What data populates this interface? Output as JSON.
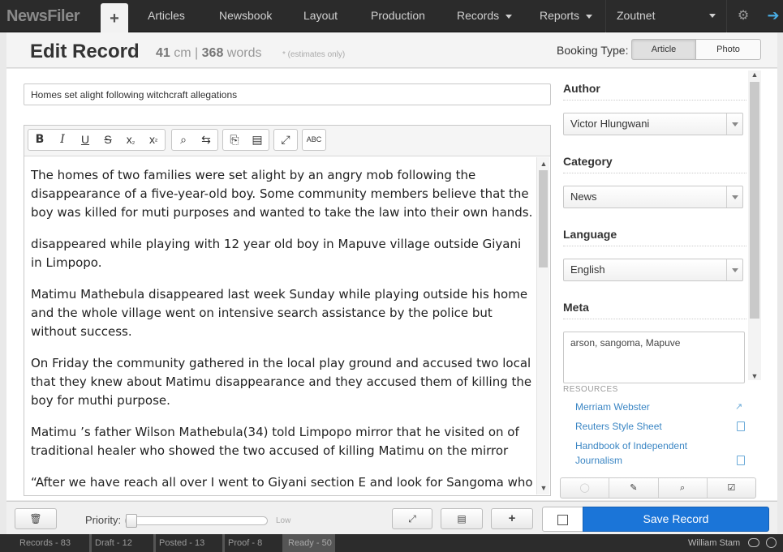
{
  "app": {
    "brand": "NewsFiler"
  },
  "nav": {
    "plus": "+",
    "items": [
      {
        "label": "Articles"
      },
      {
        "label": "Newsbook"
      },
      {
        "label": "Layout"
      },
      {
        "label": "Production"
      },
      {
        "label": "Records"
      },
      {
        "label": "Reports"
      },
      {
        "label": "Zoutnet"
      }
    ]
  },
  "header": {
    "title": "Edit Record",
    "cm_value": "41",
    "cm_unit": "cm",
    "sep": "|",
    "words_value": "368",
    "words_unit": "words",
    "estimate_note": "* (estimates only)",
    "booking_label": "Booking Type:",
    "booking_options": [
      "Article",
      "Photo"
    ],
    "booking_selected": "Article"
  },
  "record": {
    "headline": "Homes set alight following witchcraft allegations",
    "body": [
      "The homes of two families were set alight by an angry mob following the disappearance of a five-year-old boy. Some community members believe that the boy was killed for muti purposes and wanted to take the law into their own hands.",
      "disappeared while playing with 12 year old boy in Mapuve village outside Giyani in Limpopo.",
      "Matimu Mathebula disappeared last week Sunday while playing outside his home and the whole village went on intensive search assistance by the police but without success.",
      "On Friday the community gathered in the local play ground and accused two local that they knew about Matimu disappearance and they accused them of killing the boy for muthi purpose.",
      "Matimu ’s father  Wilson Mathebula(34) told Limpopo mirror  that he visited on of traditional healer who showed the two accused of killing Matimu on the mirror",
      "“After we have reach all over I went to Giyani section E and look for Sangoma who"
    ]
  },
  "editor_toolbar": {
    "bold": "B",
    "italic": "I",
    "underline": "U",
    "strike": "S",
    "subscript": "x",
    "sub_mark": "₂",
    "superscript": "x",
    "sup_mark": "²",
    "find": "⌕",
    "replace": "⇆",
    "source": "⎘",
    "templates": "▤",
    "maximize": "⤢",
    "spellcheck": "ABC"
  },
  "sidebar": {
    "author": {
      "title": "Author",
      "value": "Victor Hlungwani"
    },
    "category": {
      "title": "Category",
      "value": "News"
    },
    "language": {
      "title": "Language",
      "value": "English"
    },
    "meta": {
      "title": "Meta",
      "value": "arson, sangoma, Mapuve"
    },
    "resources_title": "RESOURCES",
    "resources": [
      {
        "label": "Merriam Webster"
      },
      {
        "label": "Reuters Style Sheet"
      },
      {
        "label": "Handbook of Independent Journalism"
      }
    ],
    "tool_icons": [
      "chat-bubble",
      "edit-check",
      "search",
      "check-square"
    ]
  },
  "footer": {
    "priority_label": "Priority:",
    "priority_value": 0,
    "priority_low": "Low",
    "save_label": "Save Record"
  },
  "status_bar": {
    "records_label": "Records -",
    "records_count": "83",
    "draft_label": "Draft -",
    "draft_count": "12",
    "posted_label": "Posted -",
    "posted_count": "13",
    "proof_label": "Proof -",
    "proof_count": "8",
    "ready_label": "Ready -",
    "ready_count": "50",
    "user": "William Stam"
  },
  "colors": {
    "nav_bg": "#2b2b2b",
    "accent": "#1b75d8",
    "link": "#3b86c4"
  }
}
